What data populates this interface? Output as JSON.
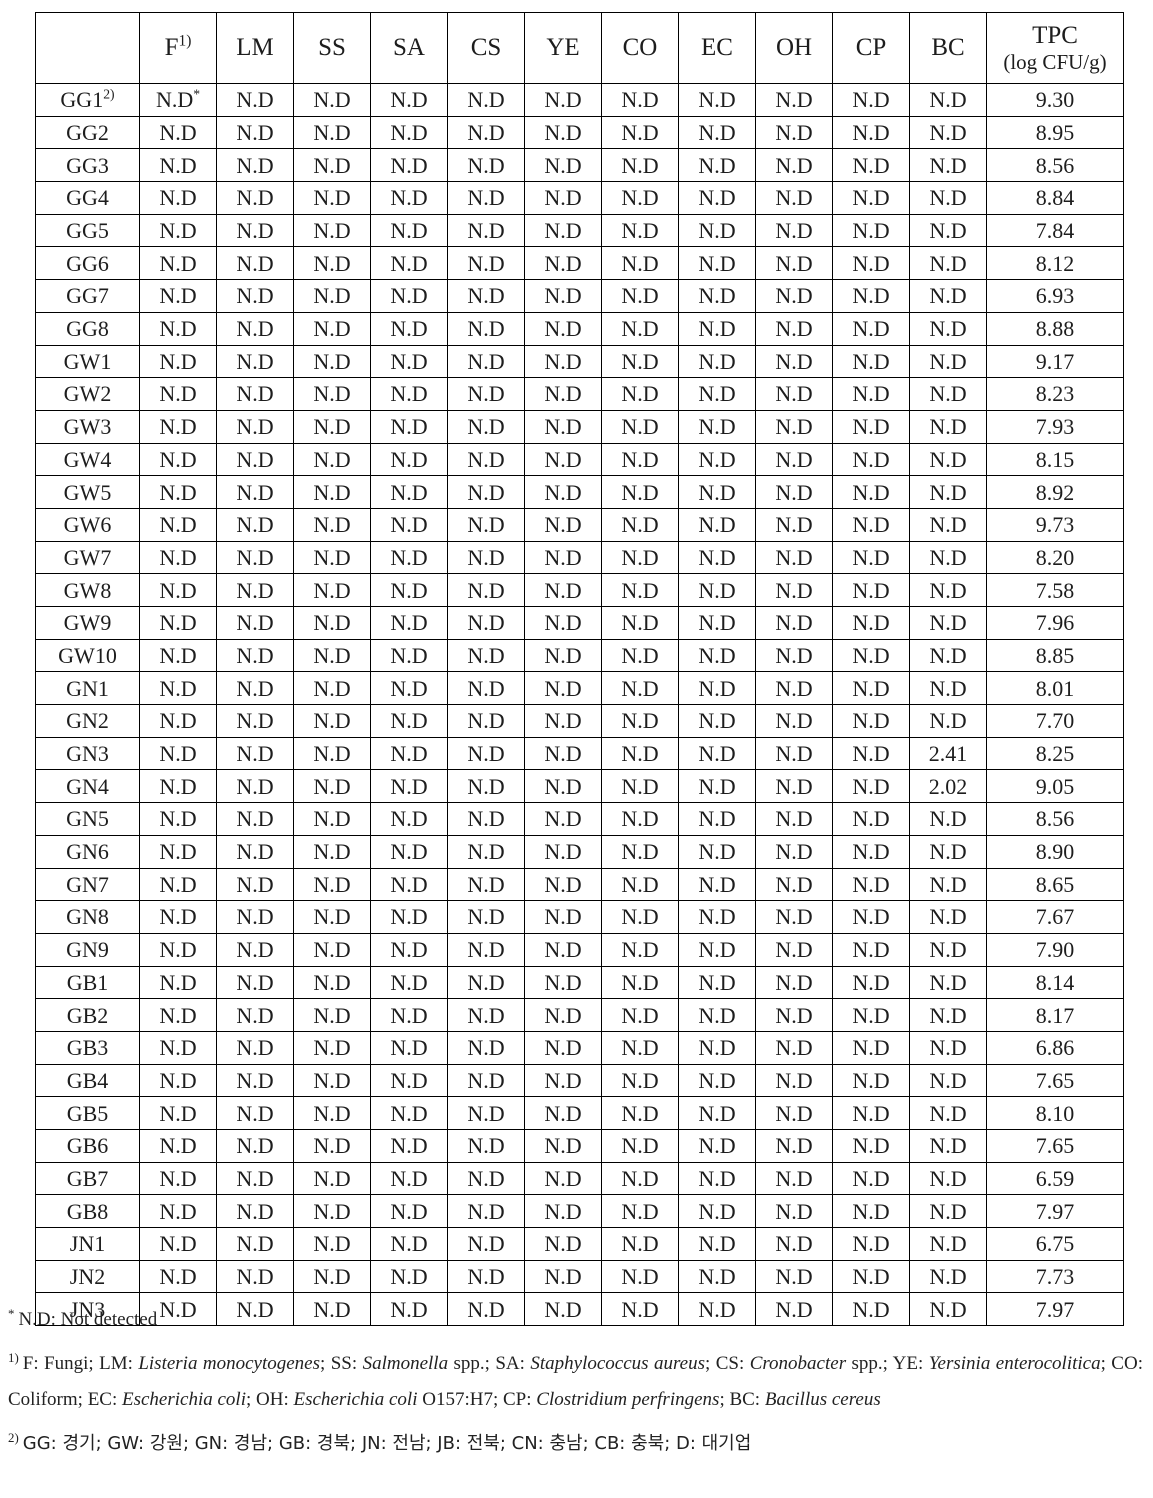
{
  "table": {
    "columns": [
      {
        "key": "sample",
        "label": "",
        "footnote": ""
      },
      {
        "key": "F",
        "label": "F",
        "footnote": "1)"
      },
      {
        "key": "LM",
        "label": "LM",
        "footnote": ""
      },
      {
        "key": "SS",
        "label": "SS",
        "footnote": ""
      },
      {
        "key": "SA",
        "label": "SA",
        "footnote": ""
      },
      {
        "key": "CS",
        "label": "CS",
        "footnote": ""
      },
      {
        "key": "YE",
        "label": "YE",
        "footnote": ""
      },
      {
        "key": "CO",
        "label": "CO",
        "footnote": ""
      },
      {
        "key": "EC",
        "label": "EC",
        "footnote": ""
      },
      {
        "key": "OH",
        "label": "OH",
        "footnote": ""
      },
      {
        "key": "CP",
        "label": "CP",
        "footnote": ""
      },
      {
        "key": "BC",
        "label": "BC",
        "footnote": ""
      },
      {
        "key": "TPC",
        "label": "TPC",
        "sublabel": "(log CFU/g)",
        "footnote": ""
      }
    ],
    "not_detected": "N.D",
    "first_cell_footnote": "2)",
    "first_value_footnote": "*",
    "rows": [
      {
        "sample": "GG1",
        "sample_footnote": "2)",
        "F": "N.D",
        "F_footnote": "*",
        "LM": "N.D",
        "SS": "N.D",
        "SA": "N.D",
        "CS": "N.D",
        "YE": "N.D",
        "CO": "N.D",
        "EC": "N.D",
        "OH": "N.D",
        "CP": "N.D",
        "BC": "N.D",
        "TPC": "9.30"
      },
      {
        "sample": "GG2",
        "F": "N.D",
        "LM": "N.D",
        "SS": "N.D",
        "SA": "N.D",
        "CS": "N.D",
        "YE": "N.D",
        "CO": "N.D",
        "EC": "N.D",
        "OH": "N.D",
        "CP": "N.D",
        "BC": "N.D",
        "TPC": "8.95"
      },
      {
        "sample": "GG3",
        "F": "N.D",
        "LM": "N.D",
        "SS": "N.D",
        "SA": "N.D",
        "CS": "N.D",
        "YE": "N.D",
        "CO": "N.D",
        "EC": "N.D",
        "OH": "N.D",
        "CP": "N.D",
        "BC": "N.D",
        "TPC": "8.56"
      },
      {
        "sample": "GG4",
        "F": "N.D",
        "LM": "N.D",
        "SS": "N.D",
        "SA": "N.D",
        "CS": "N.D",
        "YE": "N.D",
        "CO": "N.D",
        "EC": "N.D",
        "OH": "N.D",
        "CP": "N.D",
        "BC": "N.D",
        "TPC": "8.84"
      },
      {
        "sample": "GG5",
        "F": "N.D",
        "LM": "N.D",
        "SS": "N.D",
        "SA": "N.D",
        "CS": "N.D",
        "YE": "N.D",
        "CO": "N.D",
        "EC": "N.D",
        "OH": "N.D",
        "CP": "N.D",
        "BC": "N.D",
        "TPC": "7.84"
      },
      {
        "sample": "GG6",
        "F": "N.D",
        "LM": "N.D",
        "SS": "N.D",
        "SA": "N.D",
        "CS": "N.D",
        "YE": "N.D",
        "CO": "N.D",
        "EC": "N.D",
        "OH": "N.D",
        "CP": "N.D",
        "BC": "N.D",
        "TPC": "8.12"
      },
      {
        "sample": "GG7",
        "F": "N.D",
        "LM": "N.D",
        "SS": "N.D",
        "SA": "N.D",
        "CS": "N.D",
        "YE": "N.D",
        "CO": "N.D",
        "EC": "N.D",
        "OH": "N.D",
        "CP": "N.D",
        "BC": "N.D",
        "TPC": "6.93"
      },
      {
        "sample": "GG8",
        "F": "N.D",
        "LM": "N.D",
        "SS": "N.D",
        "SA": "N.D",
        "CS": "N.D",
        "YE": "N.D",
        "CO": "N.D",
        "EC": "N.D",
        "OH": "N.D",
        "CP": "N.D",
        "BC": "N.D",
        "TPC": "8.88"
      },
      {
        "sample": "GW1",
        "F": "N.D",
        "LM": "N.D",
        "SS": "N.D",
        "SA": "N.D",
        "CS": "N.D",
        "YE": "N.D",
        "CO": "N.D",
        "EC": "N.D",
        "OH": "N.D",
        "CP": "N.D",
        "BC": "N.D",
        "TPC": "9.17"
      },
      {
        "sample": "GW2",
        "F": "N.D",
        "LM": "N.D",
        "SS": "N.D",
        "SA": "N.D",
        "CS": "N.D",
        "YE": "N.D",
        "CO": "N.D",
        "EC": "N.D",
        "OH": "N.D",
        "CP": "N.D",
        "BC": "N.D",
        "TPC": "8.23"
      },
      {
        "sample": "GW3",
        "F": "N.D",
        "LM": "N.D",
        "SS": "N.D",
        "SA": "N.D",
        "CS": "N.D",
        "YE": "N.D",
        "CO": "N.D",
        "EC": "N.D",
        "OH": "N.D",
        "CP": "N.D",
        "BC": "N.D",
        "TPC": "7.93"
      },
      {
        "sample": "GW4",
        "F": "N.D",
        "LM": "N.D",
        "SS": "N.D",
        "SA": "N.D",
        "CS": "N.D",
        "YE": "N.D",
        "CO": "N.D",
        "EC": "N.D",
        "OH": "N.D",
        "CP": "N.D",
        "BC": "N.D",
        "TPC": "8.15"
      },
      {
        "sample": "GW5",
        "F": "N.D",
        "LM": "N.D",
        "SS": "N.D",
        "SA": "N.D",
        "CS": "N.D",
        "YE": "N.D",
        "CO": "N.D",
        "EC": "N.D",
        "OH": "N.D",
        "CP": "N.D",
        "BC": "N.D",
        "TPC": "8.92"
      },
      {
        "sample": "GW6",
        "F": "N.D",
        "LM": "N.D",
        "SS": "N.D",
        "SA": "N.D",
        "CS": "N.D",
        "YE": "N.D",
        "CO": "N.D",
        "EC": "N.D",
        "OH": "N.D",
        "CP": "N.D",
        "BC": "N.D",
        "TPC": "9.73"
      },
      {
        "sample": "GW7",
        "F": "N.D",
        "LM": "N.D",
        "SS": "N.D",
        "SA": "N.D",
        "CS": "N.D",
        "YE": "N.D",
        "CO": "N.D",
        "EC": "N.D",
        "OH": "N.D",
        "CP": "N.D",
        "BC": "N.D",
        "TPC": "8.20"
      },
      {
        "sample": "GW8",
        "F": "N.D",
        "LM": "N.D",
        "SS": "N.D",
        "SA": "N.D",
        "CS": "N.D",
        "YE": "N.D",
        "CO": "N.D",
        "EC": "N.D",
        "OH": "N.D",
        "CP": "N.D",
        "BC": "N.D",
        "TPC": "7.58"
      },
      {
        "sample": "GW9",
        "F": "N.D",
        "LM": "N.D",
        "SS": "N.D",
        "SA": "N.D",
        "CS": "N.D",
        "YE": "N.D",
        "CO": "N.D",
        "EC": "N.D",
        "OH": "N.D",
        "CP": "N.D",
        "BC": "N.D",
        "TPC": "7.96"
      },
      {
        "sample": "GW10",
        "F": "N.D",
        "LM": "N.D",
        "SS": "N.D",
        "SA": "N.D",
        "CS": "N.D",
        "YE": "N.D",
        "CO": "N.D",
        "EC": "N.D",
        "OH": "N.D",
        "CP": "N.D",
        "BC": "N.D",
        "TPC": "8.85"
      },
      {
        "sample": "GN1",
        "F": "N.D",
        "LM": "N.D",
        "SS": "N.D",
        "SA": "N.D",
        "CS": "N.D",
        "YE": "N.D",
        "CO": "N.D",
        "EC": "N.D",
        "OH": "N.D",
        "CP": "N.D",
        "BC": "N.D",
        "TPC": "8.01"
      },
      {
        "sample": "GN2",
        "F": "N.D",
        "LM": "N.D",
        "SS": "N.D",
        "SA": "N.D",
        "CS": "N.D",
        "YE": "N.D",
        "CO": "N.D",
        "EC": "N.D",
        "OH": "N.D",
        "CP": "N.D",
        "BC": "N.D",
        "TPC": "7.70"
      },
      {
        "sample": "GN3",
        "F": "N.D",
        "LM": "N.D",
        "SS": "N.D",
        "SA": "N.D",
        "CS": "N.D",
        "YE": "N.D",
        "CO": "N.D",
        "EC": "N.D",
        "OH": "N.D",
        "CP": "N.D",
        "BC": "2.41",
        "TPC": "8.25"
      },
      {
        "sample": "GN4",
        "F": "N.D",
        "LM": "N.D",
        "SS": "N.D",
        "SA": "N.D",
        "CS": "N.D",
        "YE": "N.D",
        "CO": "N.D",
        "EC": "N.D",
        "OH": "N.D",
        "CP": "N.D",
        "BC": "2.02",
        "TPC": "9.05"
      },
      {
        "sample": "GN5",
        "F": "N.D",
        "LM": "N.D",
        "SS": "N.D",
        "SA": "N.D",
        "CS": "N.D",
        "YE": "N.D",
        "CO": "N.D",
        "EC": "N.D",
        "OH": "N.D",
        "CP": "N.D",
        "BC": "N.D",
        "TPC": "8.56"
      },
      {
        "sample": "GN6",
        "F": "N.D",
        "LM": "N.D",
        "SS": "N.D",
        "SA": "N.D",
        "CS": "N.D",
        "YE": "N.D",
        "CO": "N.D",
        "EC": "N.D",
        "OH": "N.D",
        "CP": "N.D",
        "BC": "N.D",
        "TPC": "8.90"
      },
      {
        "sample": "GN7",
        "F": "N.D",
        "LM": "N.D",
        "SS": "N.D",
        "SA": "N.D",
        "CS": "N.D",
        "YE": "N.D",
        "CO": "N.D",
        "EC": "N.D",
        "OH": "N.D",
        "CP": "N.D",
        "BC": "N.D",
        "TPC": "8.65"
      },
      {
        "sample": "GN8",
        "F": "N.D",
        "LM": "N.D",
        "SS": "N.D",
        "SA": "N.D",
        "CS": "N.D",
        "YE": "N.D",
        "CO": "N.D",
        "EC": "N.D",
        "OH": "N.D",
        "CP": "N.D",
        "BC": "N.D",
        "TPC": "7.67"
      },
      {
        "sample": "GN9",
        "F": "N.D",
        "LM": "N.D",
        "SS": "N.D",
        "SA": "N.D",
        "CS": "N.D",
        "YE": "N.D",
        "CO": "N.D",
        "EC": "N.D",
        "OH": "N.D",
        "CP": "N.D",
        "BC": "N.D",
        "TPC": "7.90"
      },
      {
        "sample": "GB1",
        "F": "N.D",
        "LM": "N.D",
        "SS": "N.D",
        "SA": "N.D",
        "CS": "N.D",
        "YE": "N.D",
        "CO": "N.D",
        "EC": "N.D",
        "OH": "N.D",
        "CP": "N.D",
        "BC": "N.D",
        "TPC": "8.14"
      },
      {
        "sample": "GB2",
        "F": "N.D",
        "LM": "N.D",
        "SS": "N.D",
        "SA": "N.D",
        "CS": "N.D",
        "YE": "N.D",
        "CO": "N.D",
        "EC": "N.D",
        "OH": "N.D",
        "CP": "N.D",
        "BC": "N.D",
        "TPC": "8.17"
      },
      {
        "sample": "GB3",
        "F": "N.D",
        "LM": "N.D",
        "SS": "N.D",
        "SA": "N.D",
        "CS": "N.D",
        "YE": "N.D",
        "CO": "N.D",
        "EC": "N.D",
        "OH": "N.D",
        "CP": "N.D",
        "BC": "N.D",
        "TPC": "6.86"
      },
      {
        "sample": "GB4",
        "F": "N.D",
        "LM": "N.D",
        "SS": "N.D",
        "SA": "N.D",
        "CS": "N.D",
        "YE": "N.D",
        "CO": "N.D",
        "EC": "N.D",
        "OH": "N.D",
        "CP": "N.D",
        "BC": "N.D",
        "TPC": "7.65"
      },
      {
        "sample": "GB5",
        "F": "N.D",
        "LM": "N.D",
        "SS": "N.D",
        "SA": "N.D",
        "CS": "N.D",
        "YE": "N.D",
        "CO": "N.D",
        "EC": "N.D",
        "OH": "N.D",
        "CP": "N.D",
        "BC": "N.D",
        "TPC": "8.10"
      },
      {
        "sample": "GB6",
        "F": "N.D",
        "LM": "N.D",
        "SS": "N.D",
        "SA": "N.D",
        "CS": "N.D",
        "YE": "N.D",
        "CO": "N.D",
        "EC": "N.D",
        "OH": "N.D",
        "CP": "N.D",
        "BC": "N.D",
        "TPC": "7.65"
      },
      {
        "sample": "GB7",
        "F": "N.D",
        "LM": "N.D",
        "SS": "N.D",
        "SA": "N.D",
        "CS": "N.D",
        "YE": "N.D",
        "CO": "N.D",
        "EC": "N.D",
        "OH": "N.D",
        "CP": "N.D",
        "BC": "N.D",
        "TPC": "6.59"
      },
      {
        "sample": "GB8",
        "F": "N.D",
        "LM": "N.D",
        "SS": "N.D",
        "SA": "N.D",
        "CS": "N.D",
        "YE": "N.D",
        "CO": "N.D",
        "EC": "N.D",
        "OH": "N.D",
        "CP": "N.D",
        "BC": "N.D",
        "TPC": "7.97"
      },
      {
        "sample": "JN1",
        "F": "N.D",
        "LM": "N.D",
        "SS": "N.D",
        "SA": "N.D",
        "CS": "N.D",
        "YE": "N.D",
        "CO": "N.D",
        "EC": "N.D",
        "OH": "N.D",
        "CP": "N.D",
        "BC": "N.D",
        "TPC": "6.75"
      },
      {
        "sample": "JN2",
        "F": "N.D",
        "LM": "N.D",
        "SS": "N.D",
        "SA": "N.D",
        "CS": "N.D",
        "YE": "N.D",
        "CO": "N.D",
        "EC": "N.D",
        "OH": "N.D",
        "CP": "N.D",
        "BC": "N.D",
        "TPC": "7.73"
      },
      {
        "sample": "JN3",
        "F": "N.D",
        "LM": "N.D",
        "SS": "N.D",
        "SA": "N.D",
        "CS": "N.D",
        "YE": "N.D",
        "CO": "N.D",
        "EC": "N.D",
        "OH": "N.D",
        "CP": "N.D",
        "BC": "N.D",
        "TPC": "7.97"
      }
    ]
  },
  "footnotes": {
    "nd": {
      "marker": "*",
      "text": "N.D: Not detected"
    },
    "abbrev": {
      "marker": "1)",
      "parts": [
        {
          "t": "F: Fungi; LM: ",
          "i": false
        },
        {
          "t": "Listeria monocytogenes",
          "i": true
        },
        {
          "t": "; SS: ",
          "i": false
        },
        {
          "t": "Salmonella",
          "i": true
        },
        {
          "t": " spp.; SA: ",
          "i": false
        },
        {
          "t": "Staphylococcus aureus",
          "i": true
        },
        {
          "t": "; CS: ",
          "i": false
        },
        {
          "t": "Cronobacter",
          "i": true
        },
        {
          "t": " spp.; YE: ",
          "i": false
        },
        {
          "t": "Yersinia enterocolitica",
          "i": true
        },
        {
          "t": "; CO: Coliform; EC: ",
          "i": false
        },
        {
          "t": "Escherichia coli",
          "i": true
        },
        {
          "t": "; OH: ",
          "i": false
        },
        {
          "t": "Escherichia coli",
          "i": true
        },
        {
          "t": " O157:H7; CP: ",
          "i": false
        },
        {
          "t": "Clostridium perfringens",
          "i": true
        },
        {
          "t": "; BC: ",
          "i": false
        },
        {
          "t": "Bacillus cereus",
          "i": true
        }
      ]
    },
    "regions": {
      "marker": "2)",
      "text": "GG: 경기; GW: 강원; GN: 경남; GB: 경북; JN: 전남; JB: 전북; CN: 충남; CB: 충북; D: 대기업"
    }
  }
}
